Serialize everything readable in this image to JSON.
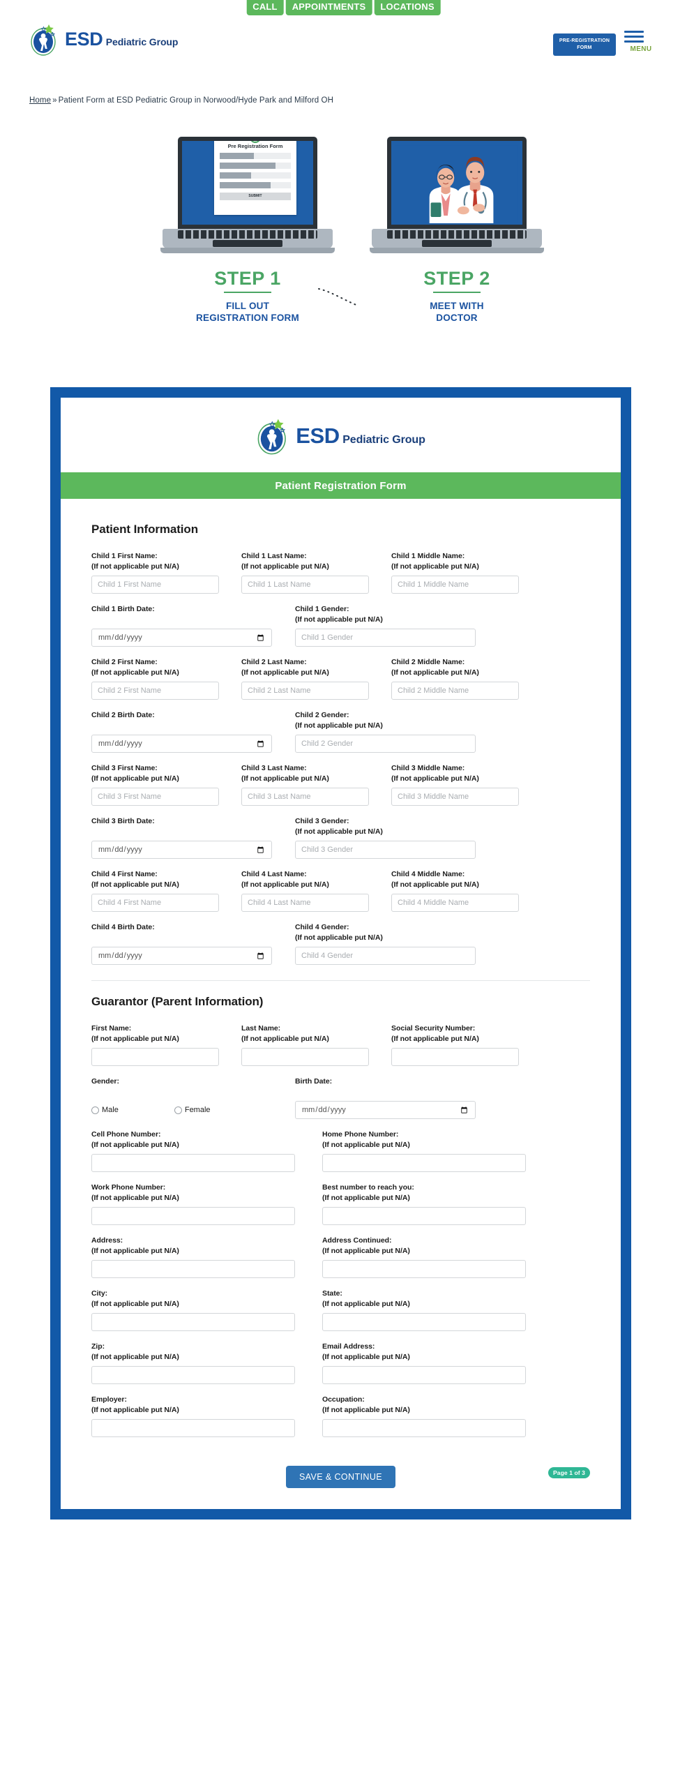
{
  "topnav": {
    "quick_buttons": [
      {
        "label": "CALL",
        "name": "call-button"
      },
      {
        "label": "APPOINTMENTS",
        "name": "appointments-button"
      },
      {
        "label": "LOCATIONS",
        "name": "locations-button"
      }
    ],
    "prereg_line1": "PRE-REGISTRATION",
    "prereg_line2": "FORM",
    "menu_label": "MENU"
  },
  "brand": {
    "name": "ESD",
    "tagline": "Pediatric Group"
  },
  "breadcrumb": {
    "home": "Home",
    "separator": "»",
    "current": "Patient Form at ESD Pediatric Group in Norwood/Hyde Park and Milford OH"
  },
  "steps": [
    {
      "num": "STEP 1",
      "desc_line1": "FILL OUT",
      "desc_line2": "REGISTRATION FORM",
      "screen_title": "Pre Registration Form",
      "screen_button": "SUBMIT"
    },
    {
      "num": "STEP 2",
      "desc_line1": "MEET WITH",
      "desc_line2": "DOCTOR"
    }
  ],
  "form": {
    "banner_title": "Patient Registration Form",
    "hint": "(If not applicable put N/A)",
    "patient_section_title": "Patient Information",
    "guarantor_section_title": "Guarantor (Parent Information)",
    "date_placeholder": "mm/dd/yyyy",
    "children": [
      {
        "first_label": "Child 1 First Name:",
        "first_ph": "Child 1 First Name",
        "last_label": "Child 1 Last Name:",
        "last_ph": "Child 1 Last Name",
        "middle_label": "Child 1 Middle Name:",
        "middle_ph": "Child 1 Middle Name",
        "birth_label": "Child 1 Birth Date:",
        "gender_label": "Child 1 Gender:",
        "gender_ph": "Child 1 Gender"
      },
      {
        "first_label": "Child 2 First Name:",
        "first_ph": "Child 2 First Name",
        "last_label": "Child 2 Last Name:",
        "last_ph": "Child 2 Last Name",
        "middle_label": "Child 2 Middle Name:",
        "middle_ph": "Child 2 Middle Name",
        "birth_label": "Child 2 Birth Date:",
        "gender_label": "Child 2 Gender:",
        "gender_ph": "Child 2 Gender"
      },
      {
        "first_label": "Child 3 First Name:",
        "first_ph": "Child 3 First Name",
        "last_label": "Child 3 Last Name:",
        "last_ph": "Child 3 Last Name",
        "middle_label": "Child 3 Middle Name:",
        "middle_ph": "Child 3 Middle Name",
        "birth_label": "Child 3 Birth Date:",
        "gender_label": "Child 3 Gender:",
        "gender_ph": "Child 3 Gender"
      },
      {
        "first_label": "Child 4 First Name:",
        "first_ph": "Child 4 First Name",
        "last_label": "Child 4 Last Name:",
        "last_ph": "Child 4 Last Name",
        "middle_label": "Child 4 Middle Name:",
        "middle_ph": "Child 4 Middle Name",
        "birth_label": "Child 4 Birth Date:",
        "gender_label": "Child 4 Gender:",
        "gender_ph": "Child 4 Gender"
      }
    ],
    "guarantor": {
      "first_name_label": "First Name:",
      "last_name_label": "Last Name:",
      "ssn_label": "Social Security Number:",
      "gender_label": "Gender:",
      "gender_male": "Male",
      "gender_female": "Female",
      "birth_date_label": "Birth Date:",
      "cell_phone_label": "Cell Phone Number:",
      "home_phone_label": "Home Phone Number:",
      "work_phone_label": "Work Phone Number:",
      "best_number_label": "Best number to reach you:",
      "address_label": "Address:",
      "address_cont_label": "Address Continued:",
      "city_label": "City:",
      "state_label": "State:",
      "zip_label": "Zip:",
      "email_label": "Email Address:",
      "employer_label": "Employer:",
      "occupation_label": "Occupation:"
    },
    "save_label": "SAVE & CONTINUE",
    "page_indicator": "Page 1 of 3"
  },
  "colors": {
    "brand_blue": "#1a52a0",
    "frame_blue": "#1259a8",
    "green": "#5cb85c",
    "step_green": "#4aa564",
    "save_blue": "#2f74b5",
    "pill_teal": "#2fb795"
  }
}
